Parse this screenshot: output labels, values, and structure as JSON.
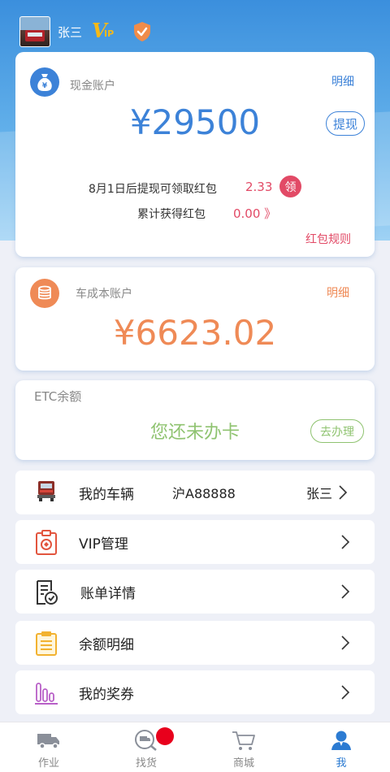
{
  "user": {
    "name": "张三"
  },
  "cash_account": {
    "label": "现金账户",
    "detail_label": "明细",
    "amount": "¥29500",
    "withdraw_label": "提现",
    "bonus_text": "8月1日后提现可领取红包",
    "bonus_value": "2.33",
    "claim_label": "领",
    "total_text": "累计获得红包",
    "total_value": "0.00 》",
    "rules_label": "红包规则"
  },
  "cost_account": {
    "label": "车成本账户",
    "detail_label": "明细",
    "amount": "¥6623.02"
  },
  "etc": {
    "label": "ETC余额",
    "status": "您还未办卡",
    "button_label": "去办理"
  },
  "menu": {
    "vehicle": {
      "label": "我的车辆",
      "plate": "沪A88888",
      "owner": "张三"
    },
    "vip": {
      "label": "VIP管理"
    },
    "bill": {
      "label": "账单详情"
    },
    "balance": {
      "label": "余额明细"
    },
    "voucher": {
      "label": "我的奖券"
    }
  },
  "tabs": [
    {
      "label": "作业",
      "icon": "truck-icon"
    },
    {
      "label": "找货",
      "icon": "search-cargo-icon"
    },
    {
      "label": "商城",
      "icon": "cart-icon"
    },
    {
      "label": "我",
      "icon": "person-icon"
    }
  ],
  "colors": {
    "brand_blue": "#3c82d8",
    "cost_orange": "#ef8a56",
    "red_accent": "#e24a66",
    "etc_green": "#8fc370",
    "active_tab": "#2c7bd2",
    "badge_red": "#e8001c"
  }
}
